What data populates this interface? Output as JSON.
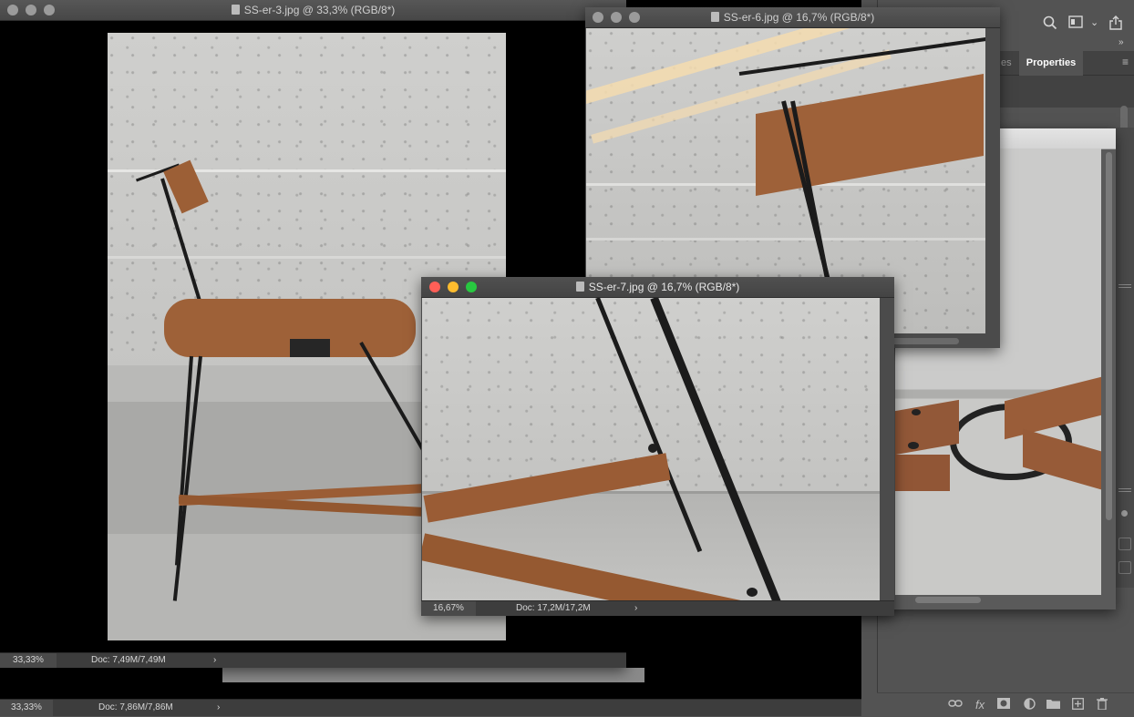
{
  "windows": {
    "back": {
      "zoom": "33,33%",
      "doc": "Doc: 7,86M/7,86M"
    },
    "er3": {
      "title": "SS-er-3.jpg @ 33,3% (RGB/8*)",
      "zoom": "33,33%",
      "doc": "Doc: 7,49M/7,49M"
    },
    "er6": {
      "title": "SS-er-6.jpg @ 16,7% (RGB/8*)"
    },
    "er7": {
      "title": "SS-er-7.jpg @ 16,7% (RGB/8*)",
      "zoom": "16,67%",
      "doc": "Doc: 17,2M/17,2M"
    }
  },
  "panel": {
    "tab_hidden": "es",
    "tab_active": "Properties"
  },
  "icons": {
    "search": "search-icon",
    "workspace": "workspace-icon",
    "share": "share-icon",
    "expand": "expand-panels-icon",
    "menu": "panel-menu-icon",
    "link": "link-layers-icon",
    "fx": "fx-icon",
    "mask": "add-mask-icon",
    "adjust": "adjustment-layer-icon",
    "folder": "group-folder-icon",
    "new": "new-layer-icon",
    "trash": "delete-icon"
  },
  "glyphs": {
    "chevron": "›",
    "dbl": "»",
    "menu": "≡",
    "down": "⌄",
    "fx": "fx"
  }
}
